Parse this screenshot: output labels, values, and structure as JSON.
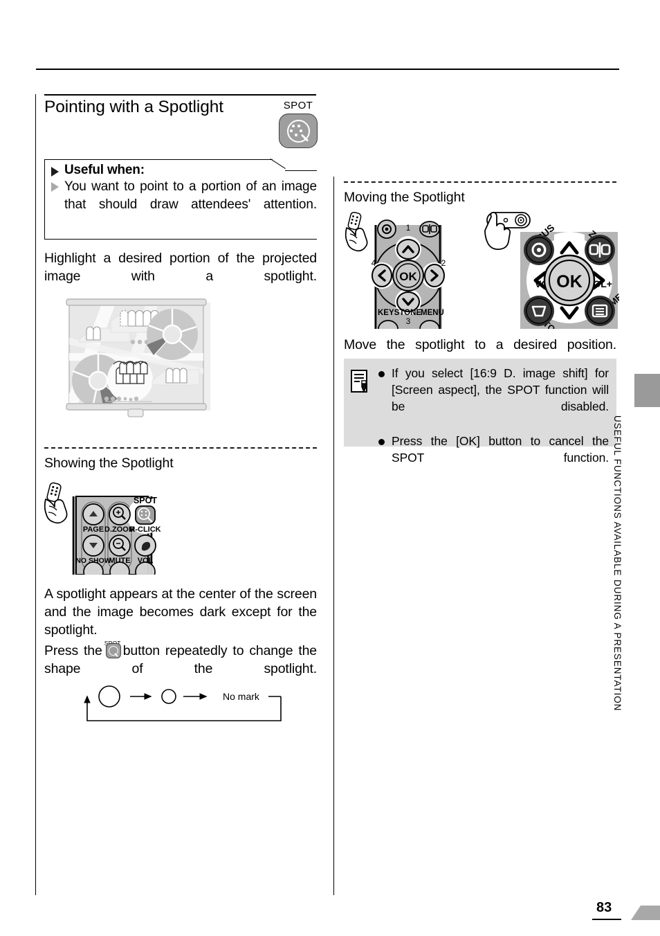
{
  "page": {
    "number": "83",
    "vertical_title": "USEFUL FUNCTIONS AVAILABLE DURING A PRESENTATION"
  },
  "header": {
    "title": "Pointing with a Spotlight",
    "badge_label": "SPOT",
    "badge_icon": "spot-key-icon"
  },
  "useful_when": {
    "heading": "Useful when:",
    "text": "You want to point to a portion of an image that should draw attendees' attention."
  },
  "left_column": {
    "intro": "Highlight a desired portion of the projected image with a spotlight.",
    "screen_illustration": {
      "name": "projected-image-with-spotlight",
      "description": "Projection screen showing a map-like slide with pie charts, groups of people icons and a circular spotlight highlight"
    },
    "showing_heading": "Showing the Spotlight",
    "remote_showing": {
      "name": "remote-control-spot-button",
      "hand_icon": "hand-holding-remote-icon",
      "highlighted_button": "SPOT",
      "button_labels": [
        "PAGE",
        "D.ZOOM",
        "SPOT",
        "R-CLICK",
        "NO SHOW",
        "MUTE",
        "VOL"
      ]
    },
    "appears_text": "A spotlight appears at the center of the screen and the image becomes dark except for the spotlight.",
    "press_text_before": "Press the",
    "press_inline_icon": "spot-button-icon",
    "press_inline_icon_label": "SPOT",
    "press_text_after": "button repeatedly to change the shape of the spotlight.",
    "shape_cycle": {
      "name": "spotlight-shape-cycle",
      "steps": [
        "large-circle",
        "small-circle",
        "No mark"
      ],
      "no_mark_label": "No mark",
      "loops": true
    }
  },
  "right_column": {
    "moving_heading": "Moving the Spotlight",
    "remote_moving": {
      "name": "remote-control-direction-buttons",
      "hand_icon": "hand-holding-remote-icon",
      "center_button": "OK",
      "numbers": [
        "1",
        "2",
        "3",
        "4"
      ],
      "corner_labels": [
        "KEYSTONE",
        "MENU"
      ]
    },
    "panel_moving": {
      "name": "projector-top-panel-direction-buttons",
      "hand_icon": "hand-pressing-panel-icon",
      "center_button": "OK",
      "labels": [
        "FOCUS",
        "ZOOM",
        "VOL-",
        "VOL+",
        "KEYSTONE",
        "MENU"
      ]
    },
    "move_text": "Move the spotlight to a desired position.",
    "note": {
      "icon": "note-pencil-icon",
      "items": [
        "If you select [16:9 D. image shift] for [Screen aspect], the SPOT function will be disabled.",
        "Press the [OK] button to cancel the SPOT function."
      ]
    }
  },
  "colors": {
    "key_gray": "#9e9e9e",
    "note_bg": "#dcdcdc",
    "tab_gray": "#9a9a9a",
    "ink": "#000000"
  }
}
